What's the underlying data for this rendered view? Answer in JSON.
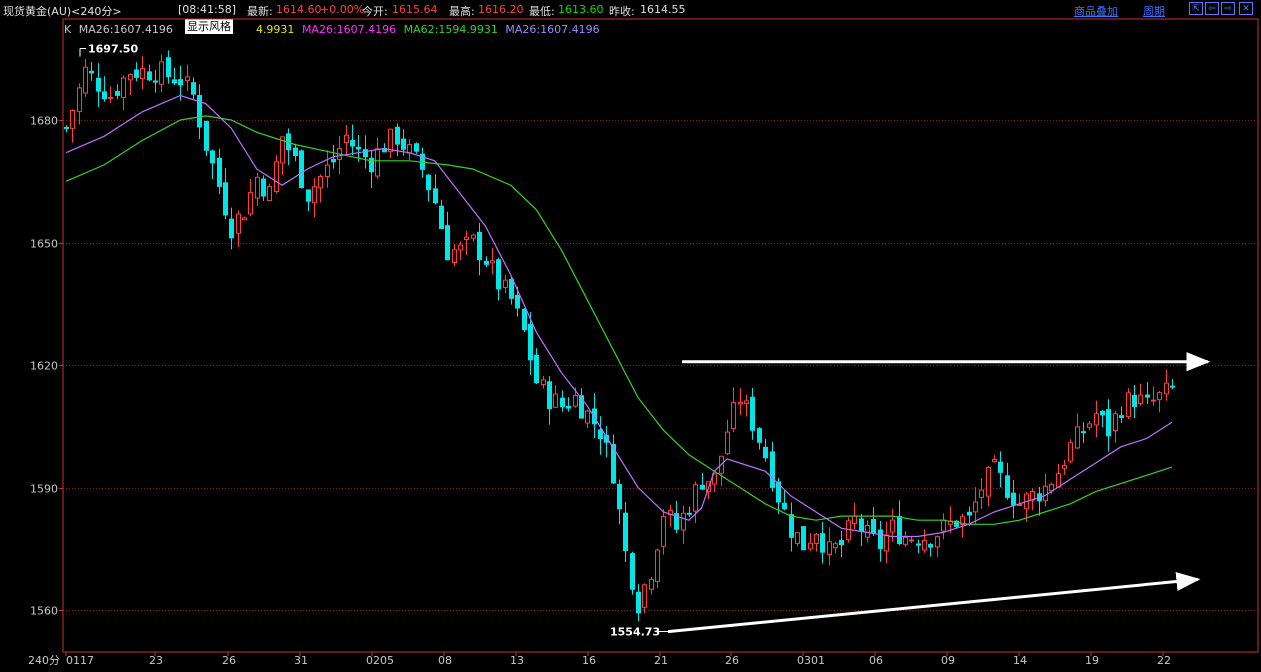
{
  "header": {
    "instrument": "现货黄金(AU)<240分>",
    "time": "08:41:58",
    "latest_label": "最新:",
    "latest_value": "1614.60",
    "change": "+0.00%",
    "open_label": "今开:",
    "open_value": "1615.64",
    "high_label": "最高:",
    "high_value": "1616.20",
    "low_label": "最低:",
    "low_value": "1613.60",
    "prev_close_label": "昨收:",
    "prev_close_value": "1614.55",
    "overlay_link": "商品叠加",
    "period_link": "周期",
    "tooltip": "显示风格"
  },
  "legend": {
    "k_label": "K",
    "items": [
      "MA26:1607.4196",
      "MA62:1594.9931",
      "MA26:1607.4196"
    ],
    "first_item": "MA26:1607.4196",
    "partial_item": "4.9931"
  },
  "footer": {
    "period_label": "240分"
  },
  "colors": {
    "up": "#ff3c3c",
    "down": "#00e5e5",
    "ma26": "#c070ff",
    "ma62": "#34d12a",
    "grid": "#7a1a1a",
    "axis": "#c83232",
    "arrow": "#ffffff"
  },
  "chart_data": {
    "type": "candlestick",
    "ylim": [
      1545,
      1705
    ],
    "yticks": [
      1560,
      1590,
      1620,
      1650,
      1680
    ],
    "xticks": [
      "0117",
      "23",
      "26",
      "31",
      "0205",
      "08",
      "13",
      "16",
      "21",
      "26",
      "0301",
      "06",
      "09",
      "14",
      "19",
      "22"
    ],
    "annotations": {
      "high": "1697.50",
      "low": "1554.73"
    },
    "trend_lines": [
      {
        "name": "resistance",
        "from": [
          1620.8
        ],
        "to": [
          1620.8
        ]
      },
      {
        "name": "support",
        "from": [
          1554.7
        ],
        "to": [
          1567.5
        ]
      }
    ],
    "series": [
      {
        "name": "MA26",
        "color": "#c070ff"
      },
      {
        "name": "MA62",
        "color": "#34d12a"
      }
    ],
    "close_path": [
      [
        0,
        1678
      ],
      [
        3,
        1692
      ],
      [
        7,
        1686
      ],
      [
        10,
        1692
      ],
      [
        14,
        1692
      ],
      [
        18,
        1690
      ],
      [
        20,
        1686
      ],
      [
        22,
        1674
      ],
      [
        24,
        1664
      ],
      [
        26,
        1654
      ],
      [
        28,
        1658
      ],
      [
        30,
        1666
      ],
      [
        32,
        1662
      ],
      [
        34,
        1676
      ],
      [
        36,
        1670
      ],
      [
        38,
        1662
      ],
      [
        40,
        1666
      ],
      [
        42,
        1670
      ],
      [
        44,
        1676
      ],
      [
        46,
        1672
      ],
      [
        48,
        1670
      ],
      [
        50,
        1674
      ],
      [
        52,
        1676
      ],
      [
        54,
        1672
      ],
      [
        56,
        1668
      ],
      [
        58,
        1660
      ],
      [
        60,
        1648
      ],
      [
        62,
        1648
      ],
      [
        64,
        1650
      ],
      [
        66,
        1646
      ],
      [
        68,
        1640
      ],
      [
        70,
        1636
      ],
      [
        72,
        1628
      ],
      [
        74,
        1616
      ],
      [
        76,
        1612
      ],
      [
        78,
        1610
      ],
      [
        80,
        1612
      ],
      [
        82,
        1608
      ],
      [
        84,
        1604
      ],
      [
        86,
        1594
      ],
      [
        88,
        1574
      ],
      [
        90,
        1562
      ],
      [
        92,
        1570
      ],
      [
        94,
        1584
      ],
      [
        96,
        1580
      ],
      [
        98,
        1586
      ],
      [
        100,
        1592
      ],
      [
        102,
        1592
      ],
      [
        104,
        1604
      ],
      [
        106,
        1612
      ],
      [
        108,
        1606
      ],
      [
        110,
        1598
      ],
      [
        112,
        1588
      ],
      [
        114,
        1580
      ],
      [
        116,
        1576
      ],
      [
        118,
        1580
      ],
      [
        120,
        1574
      ],
      [
        122,
        1576
      ],
      [
        124,
        1582
      ],
      [
        126,
        1578
      ],
      [
        128,
        1576
      ],
      [
        130,
        1580
      ],
      [
        132,
        1578
      ],
      [
        134,
        1578
      ],
      [
        136,
        1578
      ],
      [
        138,
        1580
      ],
      [
        140,
        1582
      ],
      [
        142,
        1582
      ],
      [
        144,
        1590
      ],
      [
        146,
        1594
      ],
      [
        148,
        1590
      ],
      [
        150,
        1586
      ],
      [
        152,
        1588
      ],
      [
        154,
        1590
      ],
      [
        156,
        1594
      ],
      [
        158,
        1600
      ],
      [
        160,
        1604
      ],
      [
        162,
        1608
      ],
      [
        164,
        1604
      ],
      [
        166,
        1610
      ],
      [
        168,
        1612
      ],
      [
        170,
        1610
      ],
      [
        172,
        1612
      ],
      [
        174,
        1614
      ]
    ],
    "ma26_path": [
      [
        0,
        1672
      ],
      [
        6,
        1676
      ],
      [
        12,
        1682
      ],
      [
        18,
        1686
      ],
      [
        22,
        1684
      ],
      [
        26,
        1678
      ],
      [
        30,
        1668
      ],
      [
        34,
        1664
      ],
      [
        38,
        1668
      ],
      [
        42,
        1671
      ],
      [
        46,
        1672
      ],
      [
        50,
        1673
      ],
      [
        54,
        1672
      ],
      [
        58,
        1670
      ],
      [
        62,
        1662
      ],
      [
        66,
        1654
      ],
      [
        70,
        1642
      ],
      [
        74,
        1628
      ],
      [
        78,
        1618
      ],
      [
        82,
        1610
      ],
      [
        86,
        1600
      ],
      [
        90,
        1590
      ],
      [
        94,
        1584
      ],
      [
        98,
        1582
      ],
      [
        100,
        1585
      ],
      [
        102,
        1594
      ],
      [
        104,
        1597
      ],
      [
        106,
        1596
      ],
      [
        110,
        1594
      ],
      [
        114,
        1588
      ],
      [
        118,
        1584
      ],
      [
        122,
        1580
      ],
      [
        126,
        1579
      ],
      [
        130,
        1578
      ],
      [
        134,
        1578
      ],
      [
        138,
        1579
      ],
      [
        142,
        1581
      ],
      [
        146,
        1584
      ],
      [
        150,
        1586
      ],
      [
        154,
        1588
      ],
      [
        158,
        1592
      ],
      [
        162,
        1596
      ],
      [
        166,
        1600
      ],
      [
        170,
        1602
      ],
      [
        174,
        1606
      ]
    ],
    "ma62_path": [
      [
        0,
        1665
      ],
      [
        6,
        1669
      ],
      [
        12,
        1675
      ],
      [
        18,
        1680
      ],
      [
        22,
        1681
      ],
      [
        26,
        1680
      ],
      [
        30,
        1677
      ],
      [
        36,
        1674
      ],
      [
        42,
        1672
      ],
      [
        48,
        1670
      ],
      [
        54,
        1670
      ],
      [
        60,
        1669
      ],
      [
        64,
        1668
      ],
      [
        70,
        1664
      ],
      [
        74,
        1658
      ],
      [
        78,
        1648
      ],
      [
        82,
        1636
      ],
      [
        86,
        1624
      ],
      [
        90,
        1612
      ],
      [
        94,
        1604
      ],
      [
        98,
        1598
      ],
      [
        102,
        1594
      ],
      [
        106,
        1590
      ],
      [
        110,
        1586
      ],
      [
        114,
        1583
      ],
      [
        118,
        1582
      ],
      [
        122,
        1583
      ],
      [
        126,
        1583
      ],
      [
        130,
        1583
      ],
      [
        134,
        1582
      ],
      [
        138,
        1582
      ],
      [
        142,
        1581
      ],
      [
        146,
        1581
      ],
      [
        150,
        1582
      ],
      [
        154,
        1584
      ],
      [
        158,
        1586
      ],
      [
        162,
        1589
      ],
      [
        166,
        1591
      ],
      [
        170,
        1593
      ],
      [
        174,
        1595
      ]
    ]
  }
}
